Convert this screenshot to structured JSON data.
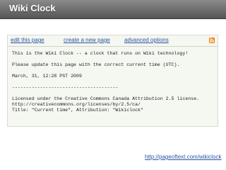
{
  "header": {
    "title": "Wiki Clock"
  },
  "nav": {
    "edit_label": "edit this page",
    "create_label": "create a new page",
    "advanced_label": "advanced options"
  },
  "content": {
    "line1": "This is the Wiki Clock -- a clock that runs on Wiki technology!",
    "line2": "Please update this page with the correct current time (UTC).",
    "line3": "March, 31, 12:28 PST 2009",
    "separator": "--------------------------------------",
    "license1": "Licensed under the Creative Commons Canada Attribution 2.5 license.",
    "license2": "http://creativecommons.org/licenses/by/2.5/ca/",
    "license3": "Title: \"Current time\", Attribution: \"Wikiclock\""
  },
  "footer": {
    "url": "http://pageoftext.com/wikiclock"
  },
  "colors": {
    "titlebar": "#6e6e6e",
    "link": "#2a55a0",
    "panel": "#f5f7f1",
    "rss": "#f38a1c"
  }
}
